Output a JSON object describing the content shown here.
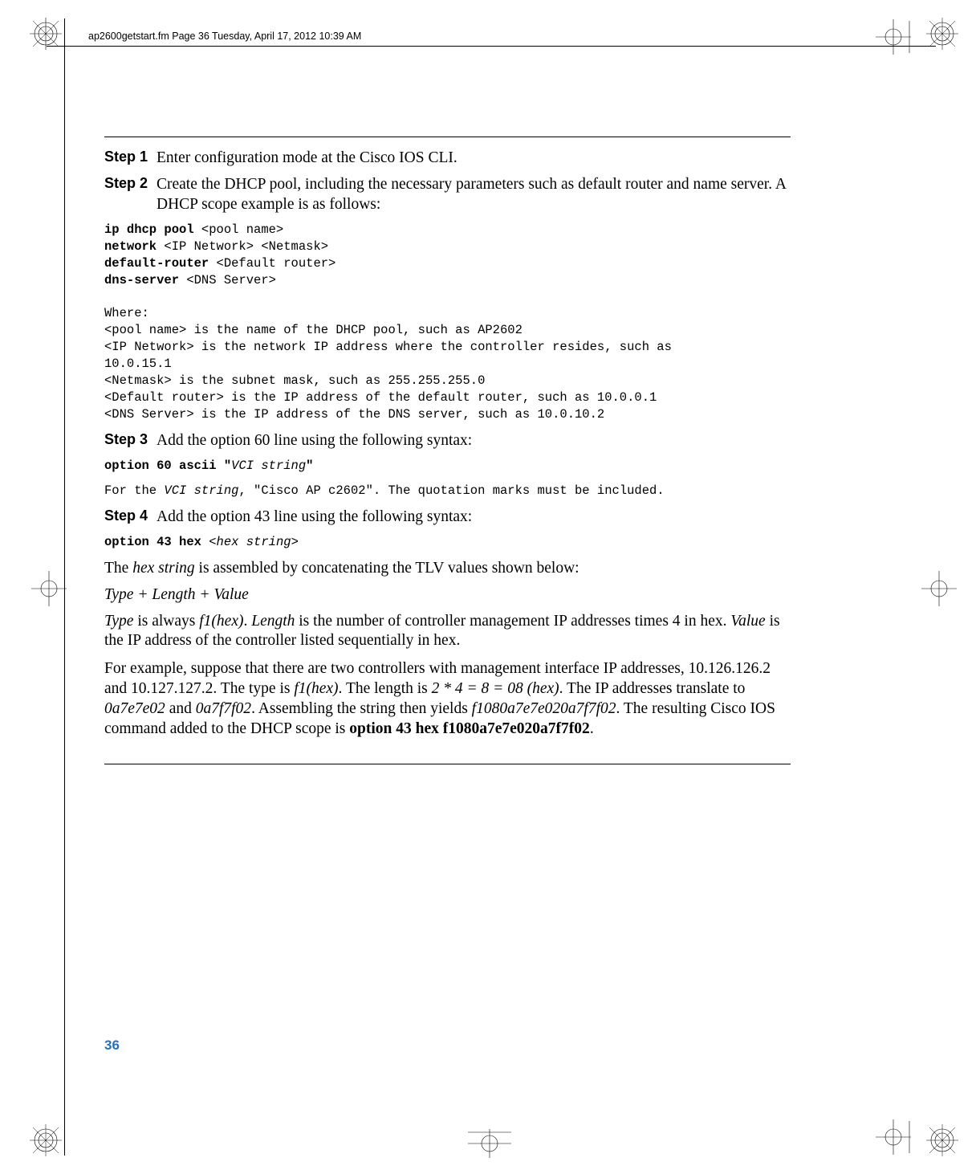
{
  "header": {
    "runhead": "ap2600getstart.fm  Page 36  Tuesday, April 17, 2012  10:39 AM"
  },
  "steps": {
    "s1": {
      "label": "Step 1",
      "text": "Enter configuration mode at the Cisco IOS CLI."
    },
    "s2": {
      "label": "Step 2",
      "text": "Create the DHCP pool, including the necessary parameters such as default router and name server. A DHCP scope example is as follows:",
      "code": {
        "l1a": "ip dhcp pool ",
        "l1b": "<pool name>",
        "l2a": "network ",
        "l2b": "<IP Network> <Netmask>",
        "l3a": "default-router ",
        "l3b": "<Default router>",
        "l4a": "dns-server ",
        "l4b": "<DNS Server>",
        "blank": "",
        "w": "Where:",
        "w1": "<pool name> is the name of the DHCP pool, such as AP2602",
        "w2": "<IP Network> is the network IP address where the controller resides, such as ",
        "w2b": "10.0.15.1",
        "w3": "<Netmask> is the subnet mask, such as 255.255.255.0",
        "w4": "<Default router> is the IP address of the default router, such as 10.0.0.1",
        "w5": "<DNS Server> is the IP address of the DNS server, such as 10.0.10.2"
      }
    },
    "s3": {
      "label": "Step 3",
      "text": "Add the option 60 line using the following syntax:",
      "code": {
        "l1a": "option 60 ascii \"",
        "l1b": "VCI string",
        "l1c": "\""
      },
      "note": {
        "a": "For the ",
        "b": "VCI string",
        "c": ", \"Cisco AP c2602\". The quotation marks must be included."
      }
    },
    "s4": {
      "label": "Step 4",
      "text": "Add the option 43 line using the following syntax:",
      "code": {
        "l1a": "option 43 hex ",
        "l1b": "<",
        "l1c": "hex string",
        "l1d": ">"
      },
      "p1": {
        "a": "The ",
        "b": "hex string",
        "c": " is assembled by concatenating the TLV values shown below:"
      },
      "p2": "Type + Length + Value",
      "p3": {
        "a": "Type",
        "b": " is always ",
        "c": "f1(hex)",
        "d": ". ",
        "e": "Length",
        "f": " is the number of controller management IP addresses times 4 in hex. ",
        "g": "Value",
        "h": " is the IP address of the controller listed sequentially in hex."
      }
    }
  },
  "example": {
    "t1": "For example, suppose that there are two controllers with management interface IP addresses, 10.126.126.2 and 10.127.127.2. The type is ",
    "t2": "f1(hex)",
    "t3": ". The length is ",
    "t4": "2 * 4 = 8 = 08 (hex)",
    "t5": ". The IP addresses translate to ",
    "t6": "0a7e7e02",
    "t7": " and ",
    "t8": "0a7f7f02",
    "t9": ". Assembling the string then yields ",
    "t10": "f1080a7e7e020a7f7f02",
    "t11": ". The resulting Cisco IOS command added to the DHCP scope is ",
    "t12": "option 43 hex f1080a7e7e020a7f7f02",
    "t13": "."
  },
  "pageNumber": "36"
}
